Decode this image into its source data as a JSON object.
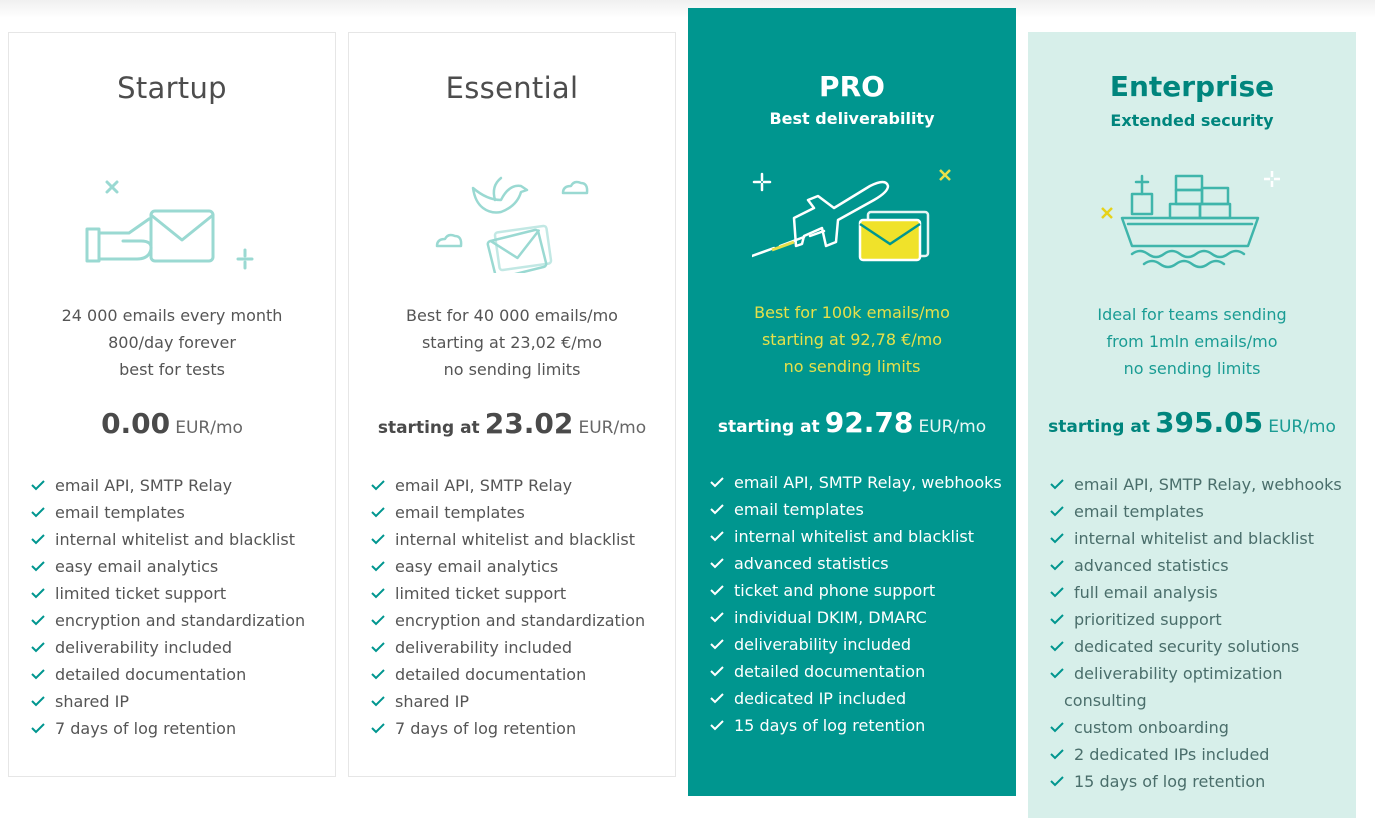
{
  "colors": {
    "teal": "#00968f",
    "teal_dark": "#00857d",
    "mint": "#d7efea",
    "yellow": "#e6e04a"
  },
  "plans": {
    "startup": {
      "title": "Startup",
      "illustration": "hand-holding-envelope-icon",
      "desc": [
        "24 000 emails every month",
        "800/day forever",
        "best for tests"
      ],
      "price": {
        "prefix": "",
        "amount": "0.00",
        "unit": "EUR/mo"
      },
      "features": [
        "email API, SMTP Relay",
        "email templates",
        "internal whitelist and blacklist",
        "easy email analytics",
        "limited ticket support",
        "encryption and standardization",
        "deliverability included",
        "detailed documentation",
        "shared IP",
        "7 days of log retention"
      ]
    },
    "essential": {
      "title": "Essential",
      "illustration": "bird-carrying-envelope-icon",
      "desc": [
        "Best for 40 000 emails/mo",
        "starting at 23,02 €/mo",
        "no sending limits"
      ],
      "price": {
        "prefix": "starting at",
        "amount": "23.02",
        "unit": "EUR/mo"
      },
      "features": [
        "email API, SMTP Relay",
        "email templates",
        "internal whitelist and blacklist",
        "easy email analytics",
        "limited ticket support",
        "encryption and standardization",
        "deliverability included",
        "detailed documentation",
        "shared IP",
        "7 days of log retention"
      ]
    },
    "pro": {
      "title": "PRO",
      "subtitle": "Best deliverability",
      "illustration": "airplane-envelope-icon",
      "desc": [
        "Best for 100k emails/mo",
        "starting at 92,78 €/mo",
        "no sending limits"
      ],
      "price": {
        "prefix": "starting at",
        "amount": "92.78",
        "unit": "EUR/mo"
      },
      "features": [
        "email API, SMTP Relay, webhooks",
        "email templates",
        "internal whitelist and blacklist",
        "advanced statistics",
        "ticket and phone support",
        "individual DKIM, DMARC",
        "deliverability included",
        "detailed documentation",
        "dedicated IP included",
        "15 days of log retention"
      ]
    },
    "enterprise": {
      "title": "Enterprise",
      "subtitle": "Extended security",
      "illustration": "cargo-ship-icon",
      "desc": [
        "Ideal for teams sending",
        "from 1mln emails/mo",
        "no sending limits"
      ],
      "price": {
        "prefix": "starting at",
        "amount": "395.05",
        "unit": "EUR/mo"
      },
      "features": [
        "email API, SMTP Relay, webhooks",
        "email templates",
        "internal whitelist and blacklist",
        "advanced statistics",
        "full email analysis",
        "prioritized support",
        "dedicated security solutions",
        "deliverability optimization",
        "consulting",
        "custom onboarding",
        "2 dedicated IPs included",
        "15 days of log retention"
      ]
    }
  }
}
